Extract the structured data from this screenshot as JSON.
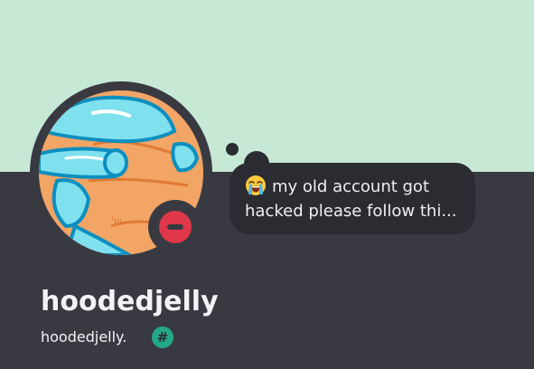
{
  "profile": {
    "display_name": "hoodedjelly",
    "username": "hoodedjelly.",
    "status": "do-not-disturb",
    "badge_symbol": "#",
    "avatar_icon": "cartoon-avatar-icon"
  },
  "custom_status": {
    "emoji": "loudly-crying-face-icon",
    "line1": "my old account got",
    "line2": "hacked please follow thi..."
  },
  "colors": {
    "banner": "#c6e8d5",
    "background": "#393a41",
    "bubble": "#2b2c31",
    "dnd": "#e0384a",
    "badge": "#23a889",
    "text": "#f2f3f5"
  }
}
